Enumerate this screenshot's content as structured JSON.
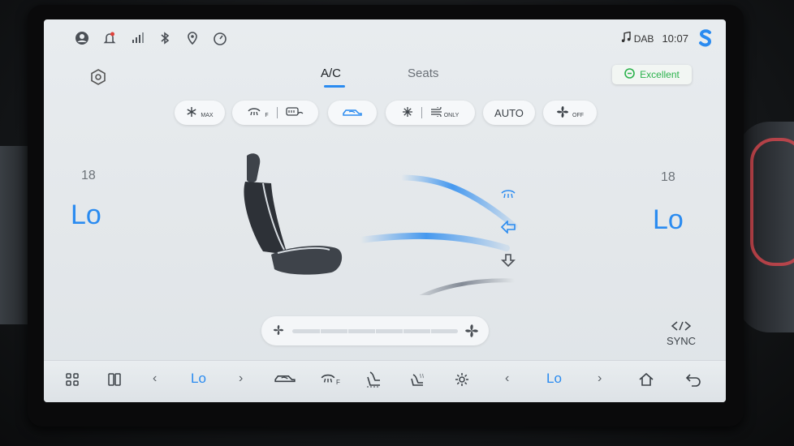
{
  "status_bar": {
    "left_icons": [
      "user-icon",
      "bell-icon",
      "signal-icon",
      "bluetooth-icon",
      "location-icon",
      "speedometer-icon"
    ],
    "audio_source": "DAB",
    "time": "10:07",
    "logo": "brand-logo"
  },
  "tabs": [
    {
      "label": "A/C",
      "active": true
    },
    {
      "label": "Seats",
      "active": false
    }
  ],
  "air_quality": {
    "label": "Excellent",
    "color": "#2bb24c"
  },
  "toolbar": {
    "max_sub": "MAX",
    "defrost_sub": "F",
    "only_sub": "ONLY",
    "auto_label": "AUTO",
    "fan_off_sub": "OFF"
  },
  "climate": {
    "left": {
      "set_temp": "18",
      "display": "Lo"
    },
    "right": {
      "set_temp": "18",
      "display": "Lo"
    },
    "airflow": [
      "windshield",
      "face",
      "feet"
    ],
    "fan_level": 0
  },
  "sync_label": "SYNC",
  "dock": {
    "left_temp": "Lo",
    "right_temp": "Lo",
    "defrost_sub": "F"
  },
  "colors": {
    "accent": "#2a8bf0",
    "good": "#2bb24c"
  }
}
